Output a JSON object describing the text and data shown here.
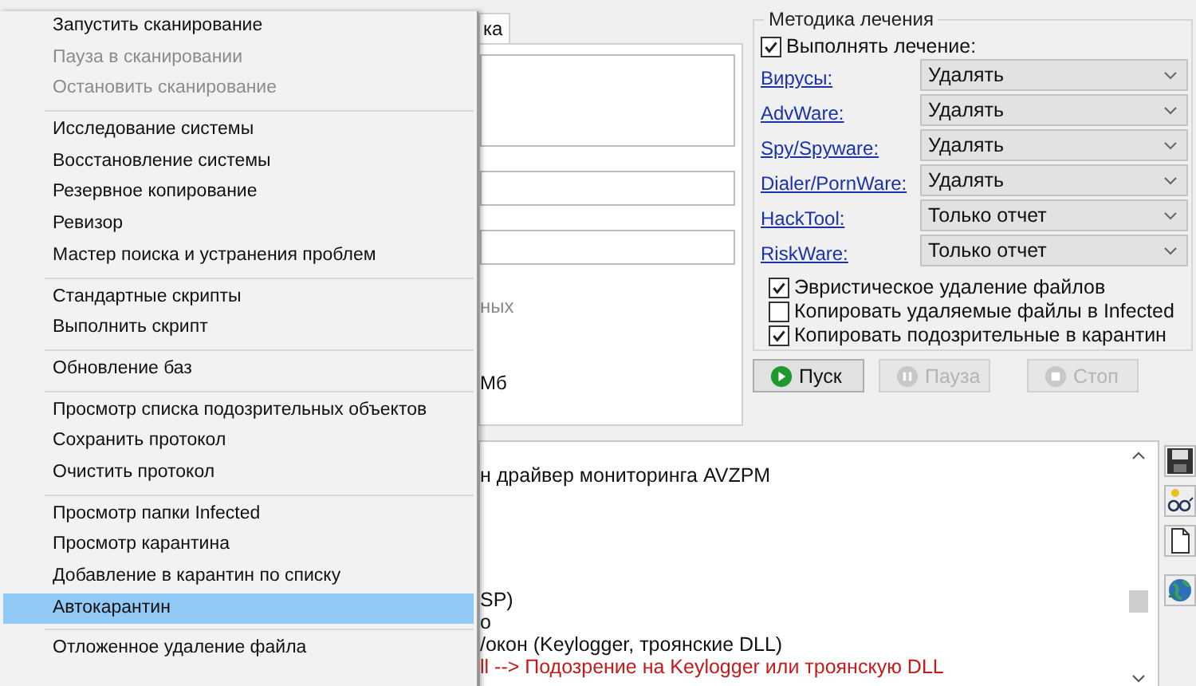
{
  "tab": {
    "label": "ка"
  },
  "left_panel": {
    "notes": [
      {
        "text": "ных",
        "disabled": true
      },
      {
        "text": "Мб",
        "disabled": false
      }
    ]
  },
  "treatment": {
    "title": "Методика лечения",
    "enable": {
      "label": "Выполнять лечение:",
      "checked": true
    },
    "rows": [
      {
        "label": "Вирусы:",
        "value": "Удалять"
      },
      {
        "label": "AdvWare:",
        "value": "Удалять"
      },
      {
        "label": "Spy/Spyware:",
        "value": "Удалять"
      },
      {
        "label": "Dialer/PornWare:",
        "value": "Удалять"
      },
      {
        "label": "HackTool:",
        "value": "Только отчет"
      },
      {
        "label": "RiskWare:",
        "value": "Только отчет"
      }
    ],
    "options": [
      {
        "label": "Эвристическое удаление файлов",
        "checked": true
      },
      {
        "label": "Копировать удаляемые файлы в  Infected",
        "checked": false
      },
      {
        "label": "Копировать подозрительные в  карантин",
        "checked": true
      }
    ]
  },
  "buttons": [
    {
      "label": "Пуск",
      "kind": "start",
      "disabled": false
    },
    {
      "label": "Пауза",
      "kind": "pause",
      "disabled": true
    },
    {
      "label": "Стоп",
      "kind": "stop",
      "disabled": true
    }
  ],
  "log": {
    "lines": [
      {
        "text": "н драйвер мониторинга AVZPM",
        "kind": "normal"
      },
      {
        "text": "SP)",
        "kind": "normal"
      },
      {
        "text": "о",
        "kind": "normal"
      },
      {
        "text": "/окон (Keylogger, троянские DLL)",
        "kind": "normal"
      },
      {
        "text": "ll --> Подозрение на Keylogger или троянскую DLL",
        "kind": "warning"
      }
    ]
  },
  "context_menu": {
    "groups": [
      [
        {
          "label": "Запустить сканирование",
          "disabled": false,
          "selected": false
        },
        {
          "label": "Пауза в сканировании",
          "disabled": true,
          "selected": false
        },
        {
          "label": "Остановить сканирование",
          "disabled": true,
          "selected": false
        }
      ],
      [
        {
          "label": "Исследование системы",
          "disabled": false,
          "selected": false
        },
        {
          "label": "Восстановление системы",
          "disabled": false,
          "selected": false
        },
        {
          "label": "Резервное копирование",
          "disabled": false,
          "selected": false
        },
        {
          "label": "Ревизор",
          "disabled": false,
          "selected": false
        },
        {
          "label": "Мастер поиска и устранения проблем",
          "disabled": false,
          "selected": false
        }
      ],
      [
        {
          "label": "Стандартные скрипты",
          "disabled": false,
          "selected": false
        },
        {
          "label": "Выполнить скрипт",
          "disabled": false,
          "selected": false
        }
      ],
      [
        {
          "label": "Обновление баз",
          "disabled": false,
          "selected": false
        }
      ],
      [
        {
          "label": "Просмотр списка подозрительных объектов",
          "disabled": false,
          "selected": false
        },
        {
          "label": "Сохранить протокол",
          "disabled": false,
          "selected": false
        },
        {
          "label": "Очистить протокол",
          "disabled": false,
          "selected": false
        }
      ],
      [
        {
          "label": "Просмотр папки Infected",
          "disabled": false,
          "selected": false
        },
        {
          "label": "Просмотр карантина",
          "disabled": false,
          "selected": false
        },
        {
          "label": "Добавление в карантин по списку",
          "disabled": false,
          "selected": false
        },
        {
          "label": "Автокарантин",
          "disabled": false,
          "selected": true
        }
      ],
      [
        {
          "label": "Отложенное удаление файла",
          "disabled": false,
          "selected": false
        }
      ]
    ]
  }
}
